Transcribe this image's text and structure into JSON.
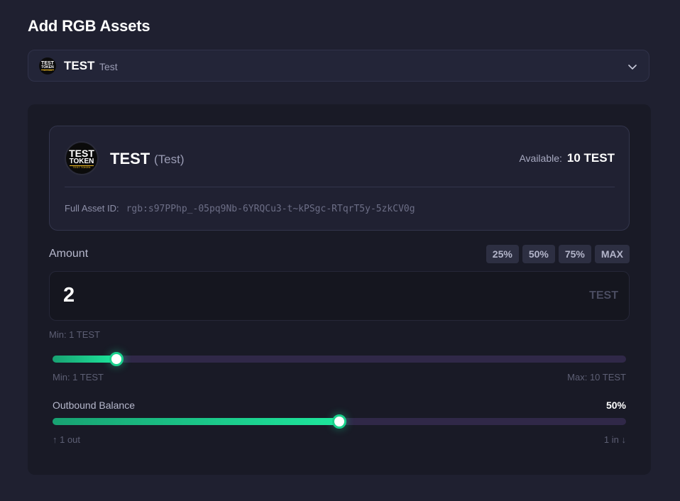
{
  "heading": "Add RGB Assets",
  "selector": {
    "ticker": "TEST",
    "name": "Test",
    "logo": {
      "line1": "TEST",
      "line2": "TOKEN",
      "line3": "TEST TOKEN"
    }
  },
  "asset_card": {
    "ticker": "TEST",
    "name": "(Test)",
    "available_label": "Available:",
    "available_value": "10 TEST",
    "asset_id_label": "Full Asset ID:",
    "asset_id_value": "rgb:s97PPhp_-05pq9Nb-6YRQCu3-t~kPSgc-RTqrT5y-5zkCV0g"
  },
  "amount": {
    "label": "Amount",
    "buttons": [
      "25%",
      "50%",
      "75%",
      "MAX"
    ],
    "value": "2",
    "unit": "TEST",
    "min_note": "Min: 1 TEST"
  },
  "amount_slider": {
    "min": 1,
    "max": 10,
    "value": 2,
    "min_label": "Min: 1 TEST",
    "max_label": "Max: 10 TEST"
  },
  "outbound": {
    "label": "Outbound Balance",
    "value_text": "50%",
    "percent": 50,
    "left_label": "↑ 1 out",
    "right_label": "1 in ↓"
  },
  "colors": {
    "background": "#1f2030",
    "panel": "#191a26",
    "accent_green": "#1ee79d",
    "track_purple": "#302848"
  },
  "icons": {
    "chevron": "chevron-down-icon",
    "token_logo": "token-logo-icon"
  }
}
